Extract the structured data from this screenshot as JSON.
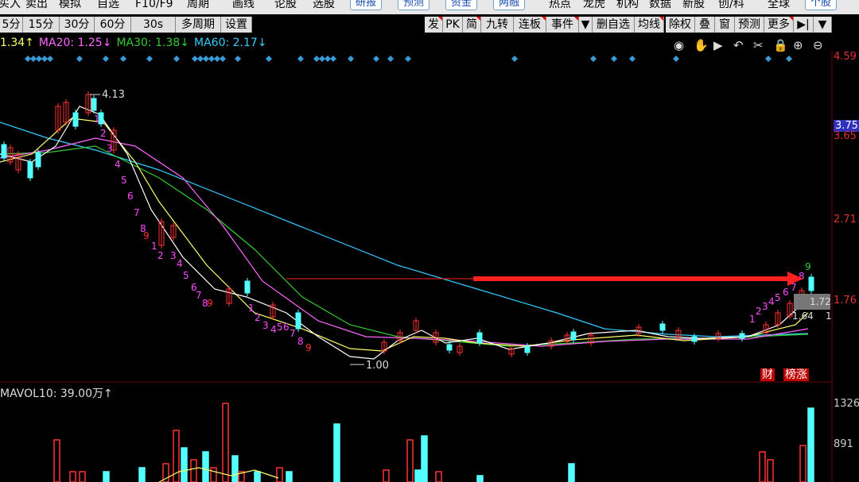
{
  "menubar": {
    "items": [
      {
        "label": "买入"
      },
      {
        "label": "卖出"
      },
      {
        "label": "模拟"
      },
      {
        "label": "自选"
      },
      {
        "label": "F10/F9"
      },
      {
        "label": "周期"
      },
      {
        "label": "画线"
      },
      {
        "label": "论股"
      },
      {
        "label": "选股"
      }
    ],
    "pills": [
      {
        "label": "研报"
      },
      {
        "label": "预测"
      },
      {
        "label": "资金"
      },
      {
        "label": "两融"
      }
    ],
    "right_items": [
      {
        "label": "热点"
      },
      {
        "label": "龙虎"
      },
      {
        "label": "机构"
      },
      {
        "label": "数据"
      },
      {
        "label": "新股"
      },
      {
        "label": "创/科"
      },
      {
        "label": "全球"
      }
    ],
    "last_pill": "个股"
  },
  "toolbar": {
    "left": [
      {
        "label": "5分"
      },
      {
        "label": "15分"
      },
      {
        "label": "30分"
      },
      {
        "label": "60分"
      },
      {
        "label": "30s"
      },
      {
        "label": "多周期"
      },
      {
        "label": "设置"
      }
    ],
    "right": [
      {
        "label": "发"
      },
      {
        "label": "PK"
      },
      {
        "label": "简"
      },
      {
        "label": "九转"
      },
      {
        "label": "连板"
      },
      {
        "label": "事件"
      },
      {
        "label": "▼"
      },
      {
        "label": "删自选"
      },
      {
        "label": "均线"
      },
      {
        "label": "除权"
      },
      {
        "label": "叠"
      },
      {
        "label": "窗"
      },
      {
        "label": "预测"
      },
      {
        "label": "更多"
      },
      {
        "label": "▶|"
      },
      {
        "label": "▼"
      }
    ]
  },
  "ma_legend": [
    {
      "text": "1.34↑",
      "color": "#ffff66"
    },
    {
      "text": "MA20: 1.25↓",
      "color": "#ff66ff"
    },
    {
      "text": "MA30: 1.38↓",
      "color": "#33cc33"
    },
    {
      "text": "MA60: 2.17↓",
      "color": "#33ccff"
    }
  ],
  "chart_tools": [
    "eye-icon",
    "hand-icon",
    "play-icon",
    "undo-icon",
    "scissors-icon",
    "lock-icon",
    "zoom-in-icon",
    "zoom-out-icon"
  ],
  "price_axis": [
    {
      "value": "4.59"
    },
    {
      "value": "3.65"
    },
    {
      "value": "2.71"
    },
    {
      "value": "1.76"
    }
  ],
  "current_price": "3.75",
  "annotations": {
    "high": "4.13",
    "low": "1.00",
    "right_value": "1.72",
    "right_value2": "1.64",
    "right_suffix": "1"
  },
  "tags": {
    "tag1": "财",
    "tag2": "榜涨"
  },
  "volume": {
    "legend": "MAVOL10: 39.00万↑",
    "axis": [
      {
        "value": "1326"
      },
      {
        "value": "891"
      }
    ]
  },
  "td_counts_sell": [
    "1",
    "2",
    "3",
    "4",
    "5",
    "6",
    "7",
    "8",
    "9"
  ],
  "td_counts_buy": [
    "1",
    "2",
    "3",
    "4",
    "5",
    "6",
    "7",
    "8",
    "9"
  ],
  "colors": {
    "up": "#ff3232",
    "down": "#54ffff",
    "ma5": "#ffffff",
    "ma10": "#ffff66",
    "ma20": "#ff66ff",
    "ma30": "#33cc33",
    "ma60": "#33ccff",
    "arrow": "#ff2020"
  }
}
